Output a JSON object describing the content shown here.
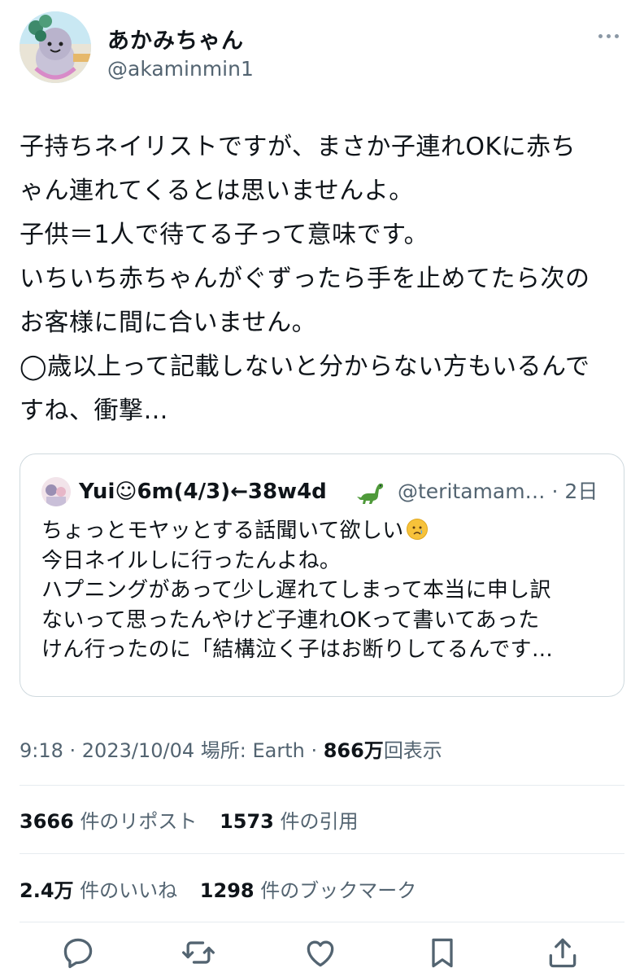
{
  "user": {
    "display_name": "あかみちゃん",
    "handle": "@akaminmin1"
  },
  "tweet": {
    "lines": [
      "子持ちネイリストですが、まさか子連れOKに赤ち",
      "ゃん連れてくるとは思いませんよ。",
      "子供＝1人で待てる子って意味です。",
      "いちいち赤ちゃんがぐずったら手を止めてたら次の",
      "お客様に間に合いません。",
      "◯歳以上って記載しないと分からない方もいるんで",
      "すね、衝撃…"
    ]
  },
  "quote": {
    "name": "Yui☺︎6m(4/3)←38w4d",
    "handle": "@teritamam…",
    "time": "2日",
    "line1": "ちょっとモヤッとする話聞いて欲しい",
    "lines": [
      "今日ネイルしに行ったんよね。",
      "ハプニングがあって少し遅れてしまって本当に申し訳",
      "ないって思ったんやけど子連れOKって書いてあった",
      "けん行ったのに「結構泣く子はお断りしてるんです…"
    ]
  },
  "meta": {
    "prefix": "9:18 · 2023/10/04 場所: Earth · ",
    "views_num": "866万",
    "views_label": "回表示"
  },
  "stats": {
    "reposts_num": "3666",
    "reposts_label": "件のリポスト",
    "quotes_num": "1573",
    "quotes_label": "件の引用",
    "likes_num": "2.4万",
    "likes_label": "件のいいね",
    "bookmarks_num": "1298",
    "bookmarks_label": "件のブックマーク"
  },
  "icons": {
    "more": "more-icon",
    "reply": "reply-icon",
    "retweet": "retweet-icon",
    "like": "heart-icon",
    "bookmark": "bookmark-icon",
    "share": "share-icon"
  },
  "colors": {
    "text": "#0f1419",
    "secondary": "#536471",
    "border": "#cfd9de"
  }
}
